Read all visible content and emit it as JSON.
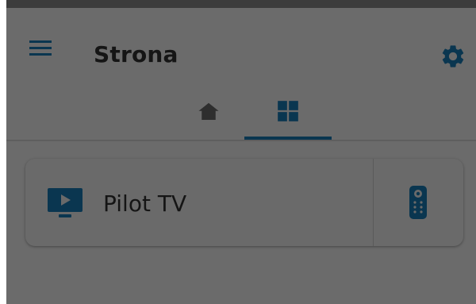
{
  "app": {
    "title": "Strona"
  },
  "icons": {
    "menu": "hamburger-menu-icon",
    "settings": "gear-icon",
    "home_tab": "home-icon",
    "devices_tab": "grid-icon",
    "tv": "tv-play-icon",
    "remote": "remote-control-icon"
  },
  "tabs": {
    "active": "devices"
  },
  "devices": [
    {
      "label": "Pilot TV"
    }
  ],
  "colors": {
    "accent": "#0a3650",
    "background": "#6b6b6b",
    "text": "#151515"
  }
}
